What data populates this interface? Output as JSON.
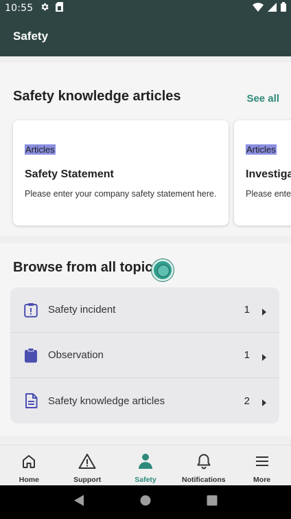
{
  "status_bar": {
    "time": "10:55",
    "left_icons": [
      "gear-icon",
      "sim-card-icon"
    ],
    "right_icons": [
      "wifi-icon",
      "signal-icon",
      "battery-icon"
    ]
  },
  "app_bar": {
    "title": "Safety"
  },
  "articles_section": {
    "title": "Safety knowledge articles",
    "see_all": "See all",
    "cards": [
      {
        "tag": "Articles",
        "title": "Safety Statement",
        "description": "Please enter your company safety statement here."
      },
      {
        "tag": "Articles",
        "title": "Investiga",
        "description": "Please enter"
      }
    ]
  },
  "topics_section": {
    "title": "Browse from all topics",
    "topics": [
      {
        "label": "Safety incident",
        "count": "1",
        "icon": "clipboard-alert-icon"
      },
      {
        "label": "Observation",
        "count": "1",
        "icon": "clipboard-icon"
      },
      {
        "label": "Safety knowledge articles",
        "count": "2",
        "icon": "document-icon"
      }
    ]
  },
  "bottom_nav": {
    "items": [
      {
        "label": "Home",
        "icon": "home-icon"
      },
      {
        "label": "Support",
        "icon": "warning-icon"
      },
      {
        "label": "Safety",
        "icon": "person-icon"
      },
      {
        "label": "Notifications",
        "icon": "bell-icon"
      },
      {
        "label": "More",
        "icon": "menu-icon"
      }
    ],
    "active": "Safety"
  },
  "colors": {
    "header_bg": "#2f4543",
    "accent": "#2e8a7c",
    "icon_purple": "#4b4fb0",
    "tag_highlight": "#8a8fe0"
  }
}
